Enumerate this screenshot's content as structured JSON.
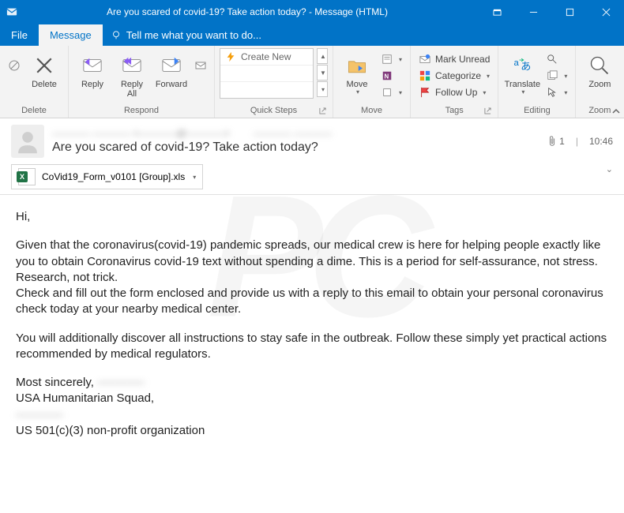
{
  "window": {
    "title": "Are you scared of covid-19? Take action today? - Message (HTML)"
  },
  "tabs": {
    "file": "File",
    "message": "Message",
    "tell_me": "Tell me what you want to do..."
  },
  "ribbon": {
    "delete": {
      "label": "Delete",
      "group": "Delete"
    },
    "respond": {
      "reply": "Reply",
      "reply_all": "Reply\nAll",
      "forward": "Forward",
      "group": "Respond"
    },
    "quick_steps": {
      "create_new": "Create New",
      "group": "Quick Steps"
    },
    "move": {
      "move": "Move",
      "group": "Move"
    },
    "tags": {
      "mark_unread": "Mark Unread",
      "categorize": "Categorize",
      "follow_up": "Follow Up",
      "group": "Tags"
    },
    "editing": {
      "translate": "Translate",
      "group": "Editing"
    },
    "zoom": {
      "zoom": "Zoom",
      "group": "Zoom"
    }
  },
  "header": {
    "from_blurred": "———— ———— <————@————>",
    "to_blurred": "———— ————",
    "subject": "Are you scared of covid-19? Take action today?",
    "time": "10:46",
    "attachment_count": "1"
  },
  "attachment": {
    "filename": "CoVid19_Form_v0101 [Group].xls"
  },
  "body": {
    "p1": "Hi,",
    "p2": "Given that the coronavirus(covid-19) pandemic spreads, our medical crew is here for helping people exactly like you to obtain Coronavirus covid-19 text without spending a dime. This is a period for self-assurance, not stress. Research, not trick.",
    "p3": "Check and fill out the form enclosed and provide us with a reply to this email to obtain your personal coronavirus check today at your nearby medical center.",
    "p4": "You will additionally discover all instructions to stay safe in the outbreak. Follow these simply yet practical actions recommended by medical regulators.",
    "sig1": "Most sincerely,",
    "sig1b": "————",
    "sig2": "USA Humanitarian Squad,",
    "sig3b": "————",
    "sig4": "US 501(c)(3) non-profit organization"
  }
}
